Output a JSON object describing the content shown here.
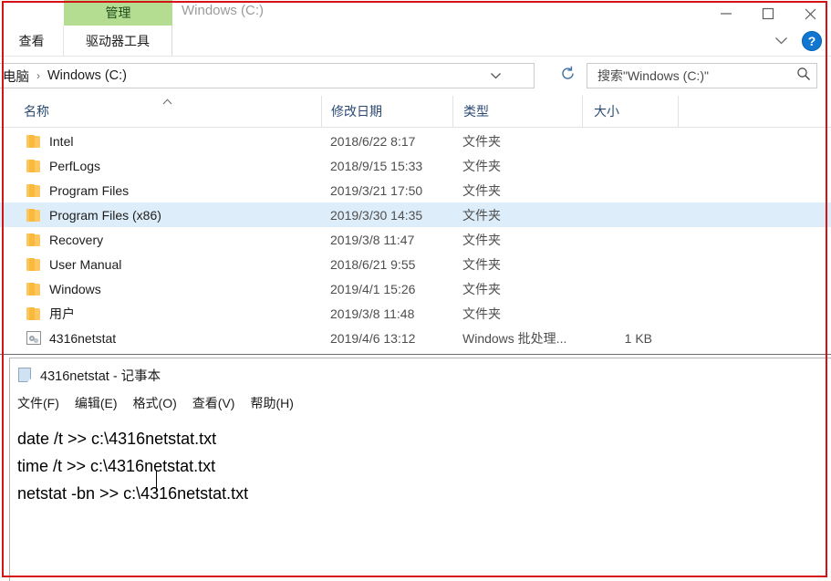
{
  "explorer": {
    "window_title": "Windows (C:)",
    "contextual_tab_header": "管理",
    "tabs": [
      {
        "label": "查看",
        "name": "tab-view"
      },
      {
        "label": "驱动器工具",
        "name": "tab-drive-tools"
      }
    ],
    "caption": {
      "minimize": "minimize-icon",
      "maximize": "maximize-icon",
      "close": "close-icon",
      "ribbon_expand": "chevron-down-icon",
      "help": "?"
    },
    "address": {
      "crumbs": [
        "电脑",
        "Windows (C:)"
      ],
      "separator": "›",
      "dropdown_icon": "chevron-down-icon",
      "refresh_icon": "refresh-icon"
    },
    "search": {
      "placeholder": "搜索\"Windows (C:)\"",
      "value": "",
      "icon": "search-icon"
    },
    "columns": [
      {
        "label": "名称",
        "sort": "▲"
      },
      {
        "label": "修改日期"
      },
      {
        "label": "类型"
      },
      {
        "label": "大小"
      }
    ],
    "files": [
      {
        "name": "Intel",
        "date": "2018/6/22 8:17",
        "type": "文件夹",
        "size": "",
        "icon": "folder-icon",
        "selected": false
      },
      {
        "name": "PerfLogs",
        "date": "2018/9/15 15:33",
        "type": "文件夹",
        "size": "",
        "icon": "folder-icon",
        "selected": false
      },
      {
        "name": "Program Files",
        "date": "2019/3/21 17:50",
        "type": "文件夹",
        "size": "",
        "icon": "folder-icon",
        "selected": false
      },
      {
        "name": "Program Files (x86)",
        "date": "2019/3/30 14:35",
        "type": "文件夹",
        "size": "",
        "icon": "folder-icon",
        "selected": true
      },
      {
        "name": "Recovery",
        "date": "2019/3/8 11:47",
        "type": "文件夹",
        "size": "",
        "icon": "folder-icon",
        "selected": false
      },
      {
        "name": "User Manual",
        "date": "2018/6/21 9:55",
        "type": "文件夹",
        "size": "",
        "icon": "folder-icon",
        "selected": false
      },
      {
        "name": "Windows",
        "date": "2019/4/1 15:26",
        "type": "文件夹",
        "size": "",
        "icon": "folder-icon",
        "selected": false
      },
      {
        "name": "用户",
        "date": "2019/3/8 11:48",
        "type": "文件夹",
        "size": "",
        "icon": "folder-icon",
        "selected": false
      },
      {
        "name": "4316netstat",
        "date": "2019/4/6 13:12",
        "type": "Windows 批处理...",
        "size": "1 KB",
        "icon": "batch-file-icon",
        "selected": false
      }
    ]
  },
  "notepad": {
    "title": "4316netstat - 记事本",
    "icon": "notepad-icon",
    "menu": [
      {
        "label": "文件(F)",
        "name": "menu-file"
      },
      {
        "label": "编辑(E)",
        "name": "menu-edit"
      },
      {
        "label": "格式(O)",
        "name": "menu-format"
      },
      {
        "label": "查看(V)",
        "name": "menu-view"
      },
      {
        "label": "帮助(H)",
        "name": "menu-help"
      }
    ],
    "lines": [
      "date /t >> c:\\4316netstat.txt",
      "time /t >> c:\\4316netstat.txt",
      "netstat -bn >> c:\\4316netstat.txt"
    ]
  },
  "annotation": {
    "border_color": "#d41317"
  }
}
